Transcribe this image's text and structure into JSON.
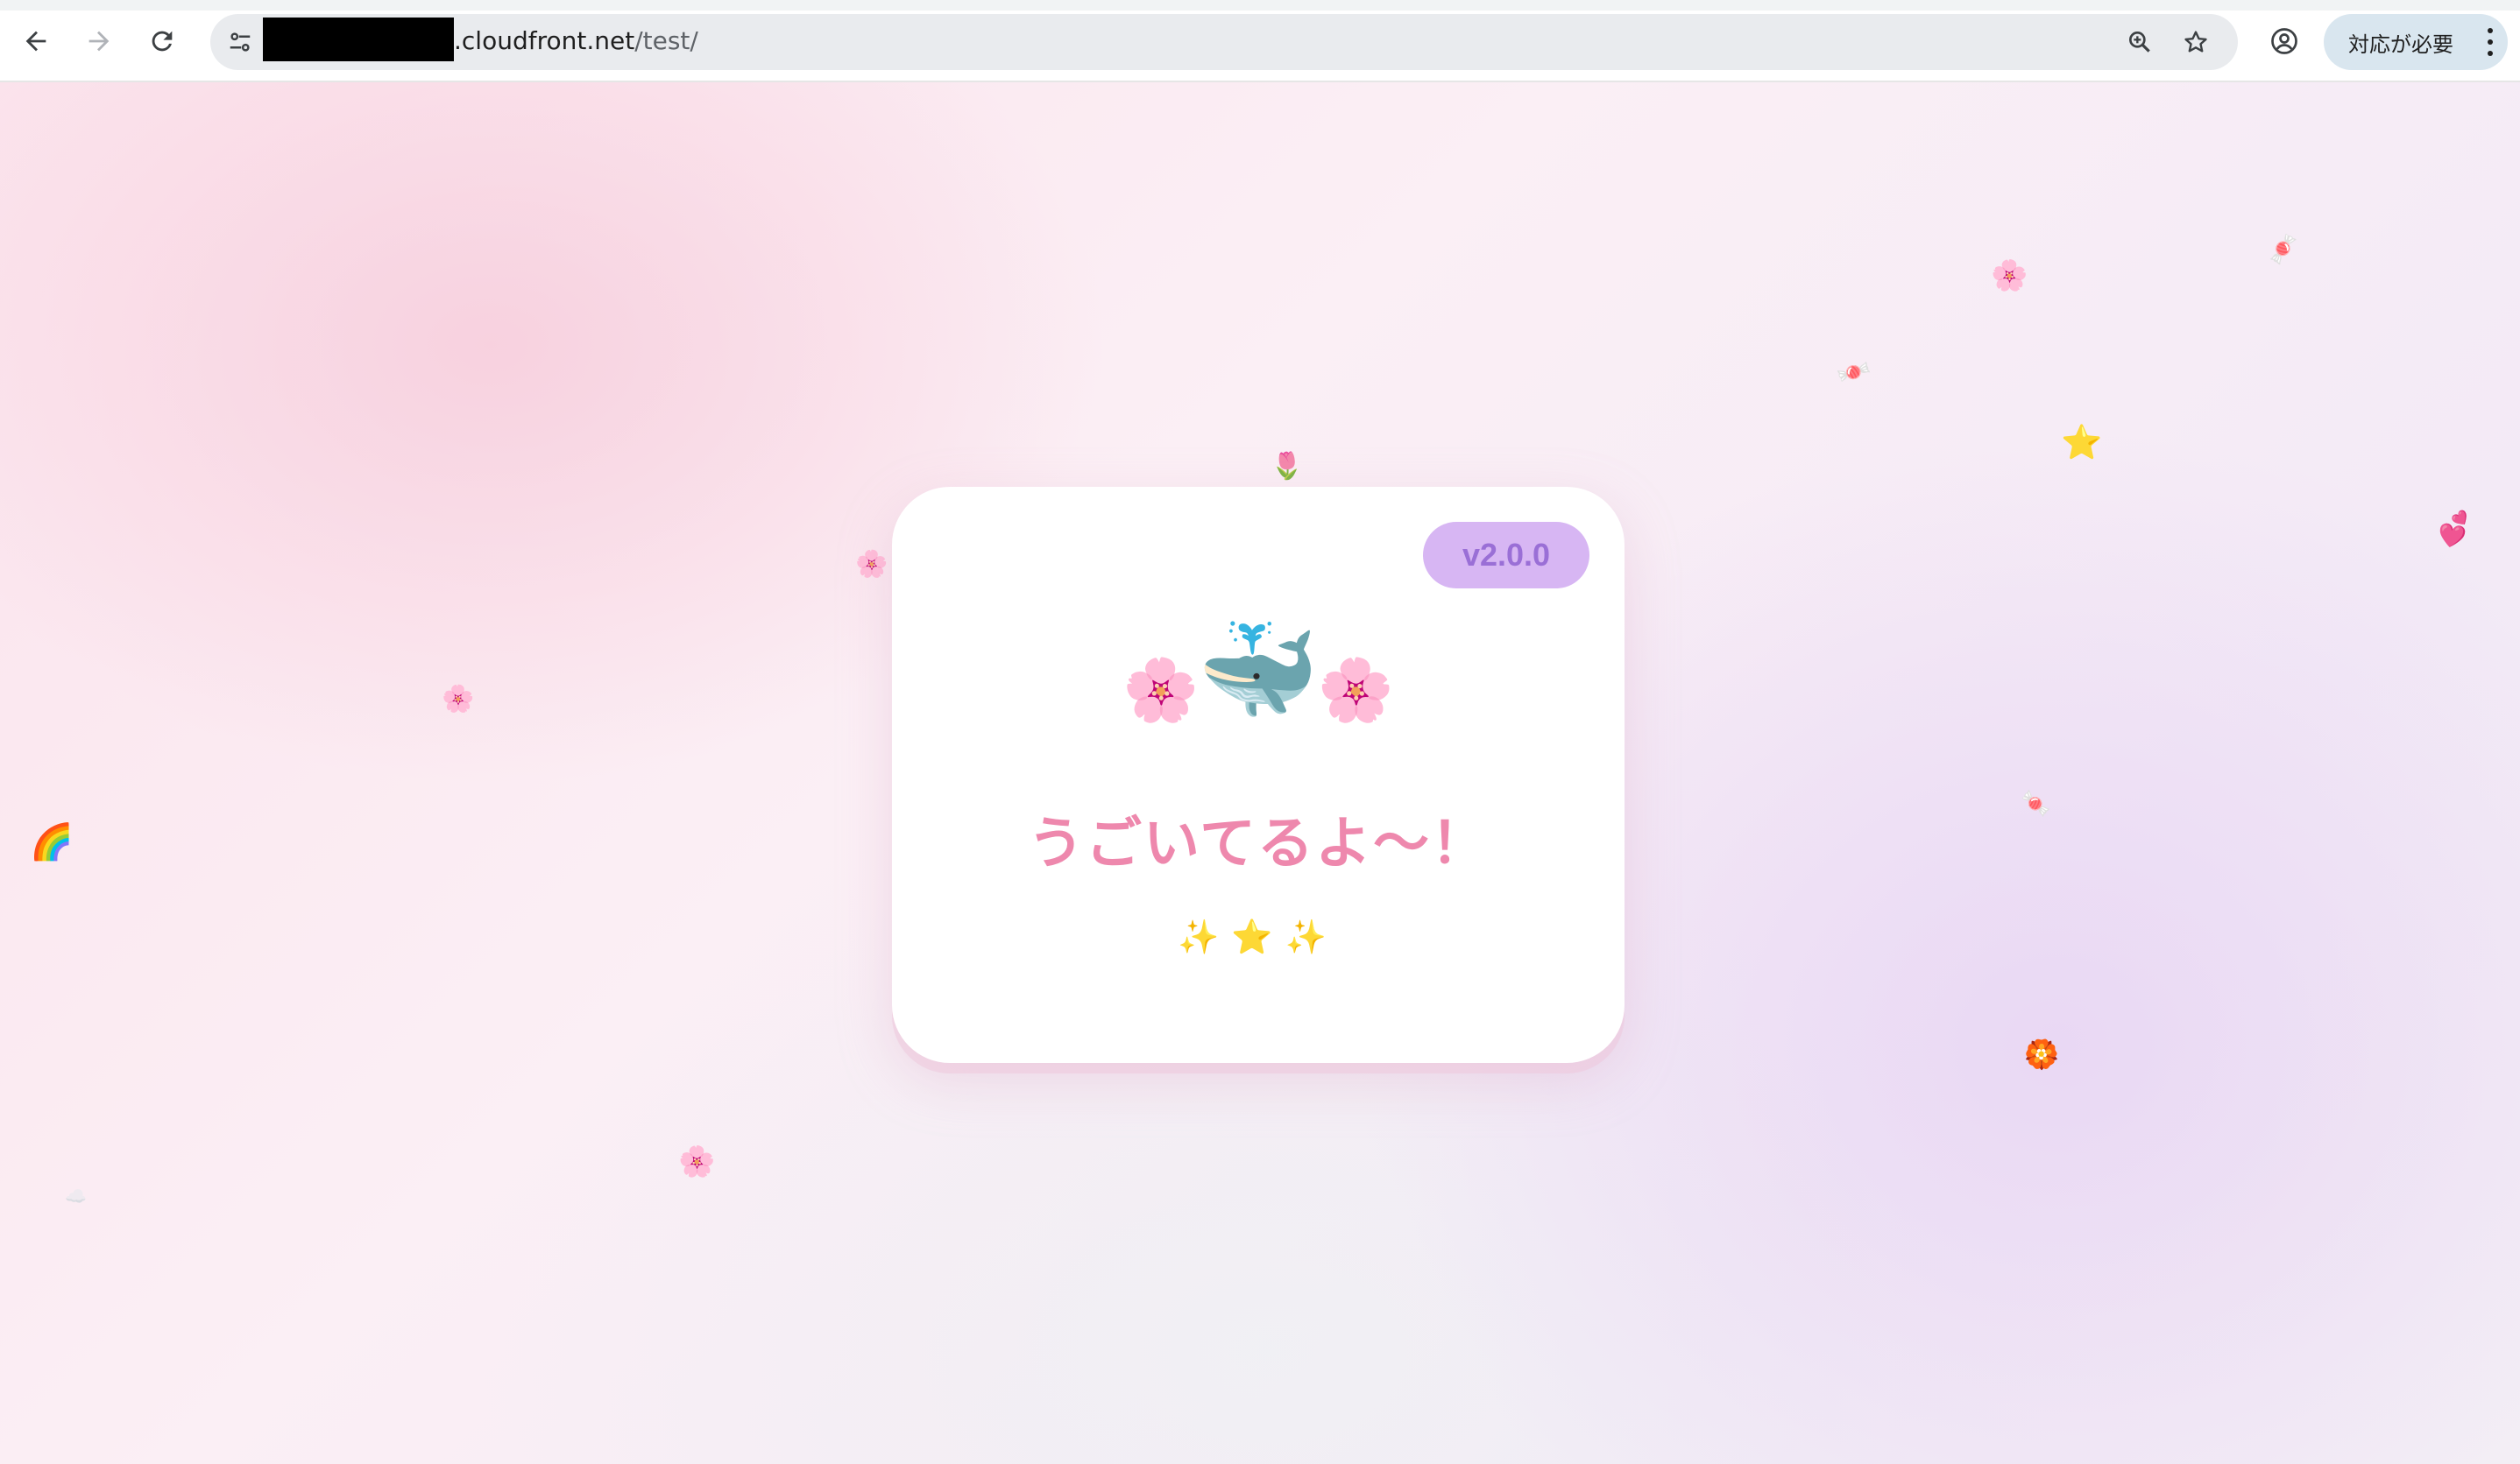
{
  "browser": {
    "url_host": ".cloudfront.net",
    "url_path": "/test/",
    "action_button_label": "対応が必要"
  },
  "page": {
    "version_badge": "v2.0.0",
    "hero_left_emoji": "🌸",
    "hero_center_emoji": "🐳",
    "hero_right_emoji": "🌸",
    "status_message": "うごいてるよ〜！",
    "sparkles": "✨⭐✨"
  },
  "floating_decorations": [
    "🌸",
    "🌸",
    "🌸",
    "🌸",
    "🌈",
    "🌷",
    "🍬",
    "🍬",
    "⭐",
    "💕",
    "🍬",
    "🏵️",
    "☁️"
  ],
  "colors": {
    "title_pink": "#ee88ad",
    "badge_bg": "#d7b6f3",
    "badge_text": "#9a6fd6"
  }
}
